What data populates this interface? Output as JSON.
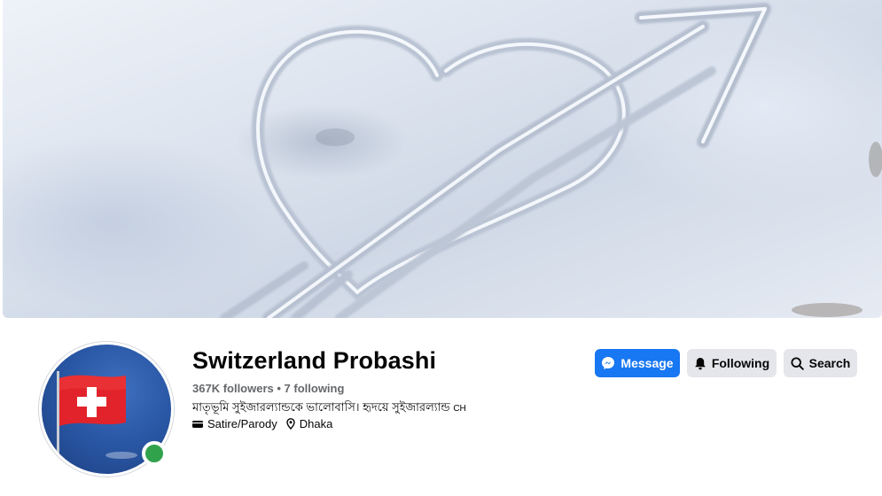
{
  "cover": {
    "description_icon": "heart-arrow-snow-photo"
  },
  "profile": {
    "name": "Switzerland Probashi",
    "followers": "367K followers",
    "separator": " • ",
    "following": "7 following",
    "bio_text": "মাতৃভূমি সুইজারল্যান্ডকে ভালোবাসি। হৃদয়ে সুইজারল্যান্ড",
    "bio_country_code": "CH",
    "category": "Satire/Parody",
    "location": "Dhaka",
    "online": true
  },
  "actions": {
    "message_label": "Message",
    "following_label": "Following",
    "search_label": "Search"
  },
  "colors": {
    "primary": "#1877f2",
    "secondary_button": "#e4e6eb",
    "online": "#31a24c",
    "muted_text": "#65676b"
  },
  "icons": {
    "message": "messenger-icon",
    "following": "bell-icon",
    "search": "search-icon",
    "category": "tag-icon",
    "location": "pin-icon"
  }
}
